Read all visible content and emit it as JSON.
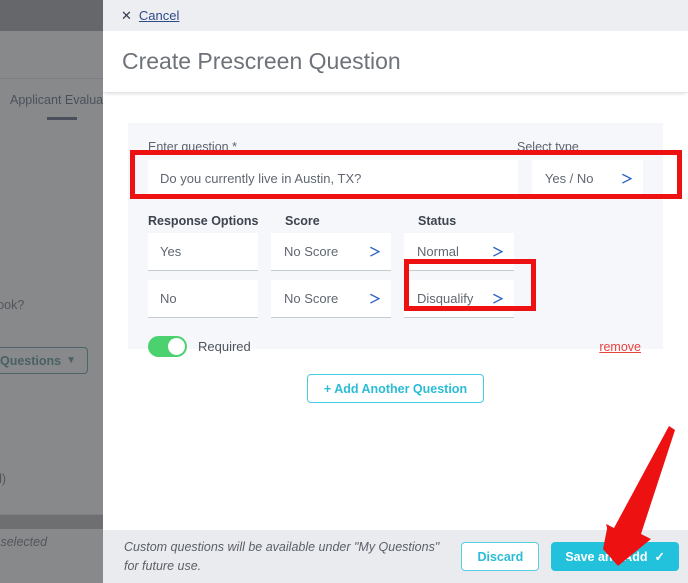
{
  "background": {
    "tab_label": "Applicant Evaluation",
    "question_text": "utlook?",
    "questions_button": "Questions",
    "questions_chevron": "chevron-down-icon",
    "ed_text": "ed)",
    "categories_text": "egories selected"
  },
  "modal": {
    "cancel": {
      "icon": "close-icon",
      "label": "Cancel"
    },
    "title": "Create Prescreen Question",
    "form": {
      "question_label": "Enter question *",
      "question_value": "Do you currently live in Austin, TX?",
      "select_type_label": "Select type",
      "select_type_value": "Yes / No",
      "columns": {
        "response_options": "Response Options",
        "score": "Score",
        "status": "Status"
      },
      "rows": [
        {
          "option": "Yes",
          "score": "No Score",
          "status": "Normal"
        },
        {
          "option": "No",
          "score": "No Score",
          "status": "Disqualify"
        }
      ],
      "required_label": "Required",
      "required_on": true,
      "remove_label": "remove",
      "add_another_label": "+ Add Another Question"
    },
    "footer": {
      "note": "Custom questions will be available under \"My Questions\" for future use.",
      "discard_label": "Discard",
      "save_label": "Save and Add",
      "save_check": "✓"
    }
  },
  "annotations": {
    "color": "#ee1111",
    "boxes": [
      "question-input-highlight",
      "disqualify-status-highlight"
    ],
    "arrow": "arrow-pointing-to-save-and-add"
  },
  "colors": {
    "accent_cyan": "#22c2dd",
    "toggle_green": "#4bd16d",
    "remove_red": "#e8423f",
    "annotation_red": "#ee1111",
    "panel_bg": "#f5f7fb"
  }
}
